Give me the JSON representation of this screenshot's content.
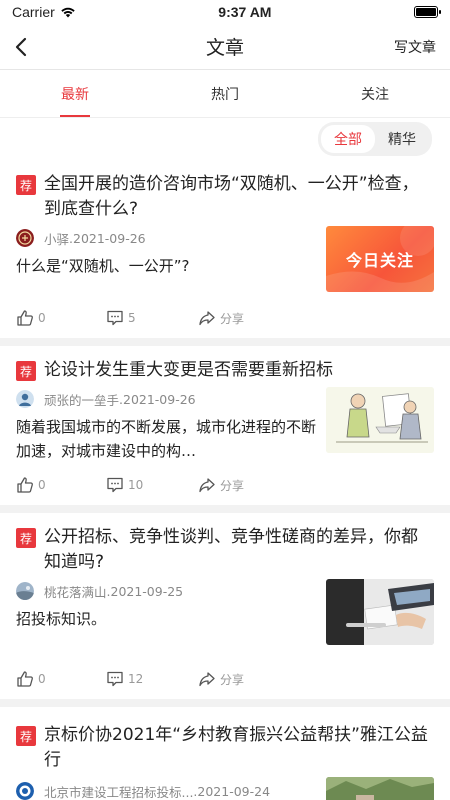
{
  "status": {
    "carrier": "Carrier",
    "time": "9:37 AM"
  },
  "nav": {
    "title": "文章",
    "write_label": "写文章"
  },
  "tabs": [
    {
      "label": "最新",
      "active": true
    },
    {
      "label": "热门",
      "active": false
    },
    {
      "label": "关注",
      "active": false
    }
  ],
  "filter": {
    "options": [
      "全部",
      "精华"
    ],
    "selected": "全部"
  },
  "badge_label": "荐",
  "colors": {
    "accent": "#e8383d"
  },
  "articles": [
    {
      "title": "全国开展的造价咨询市场“双随机、一公开”检查，到底查什么?",
      "author": "小驿",
      "date": ".2021-09-26",
      "excerpt": "什么是“双随机、一公开”?",
      "thumb_text": "今日关注",
      "likes": "0",
      "comments": "5",
      "share_label": "分享"
    },
    {
      "title": "论设计发生重大变更是否需要重新招标",
      "author": "顽张的一垒手",
      "date": ".2021-09-26",
      "excerpt": "随着我国城市的不断发展，城市化进程的不断加速，对城市建设中的构…",
      "likes": "0",
      "comments": "10",
      "share_label": "分享"
    },
    {
      "title": "公开招标、竞争性谈判、竞争性磋商的差异，你都知道吗?",
      "author": "桃花落满山",
      "date": ".2021-09-25",
      "excerpt": "招投标知识。",
      "likes": "0",
      "comments": "12",
      "share_label": "分享"
    },
    {
      "title": "京标价协2021年“乡村教育振兴公益帮扶”雅江公益行",
      "author": "北京市建设工程招标投标...",
      "date": ".2021-09-24"
    }
  ]
}
